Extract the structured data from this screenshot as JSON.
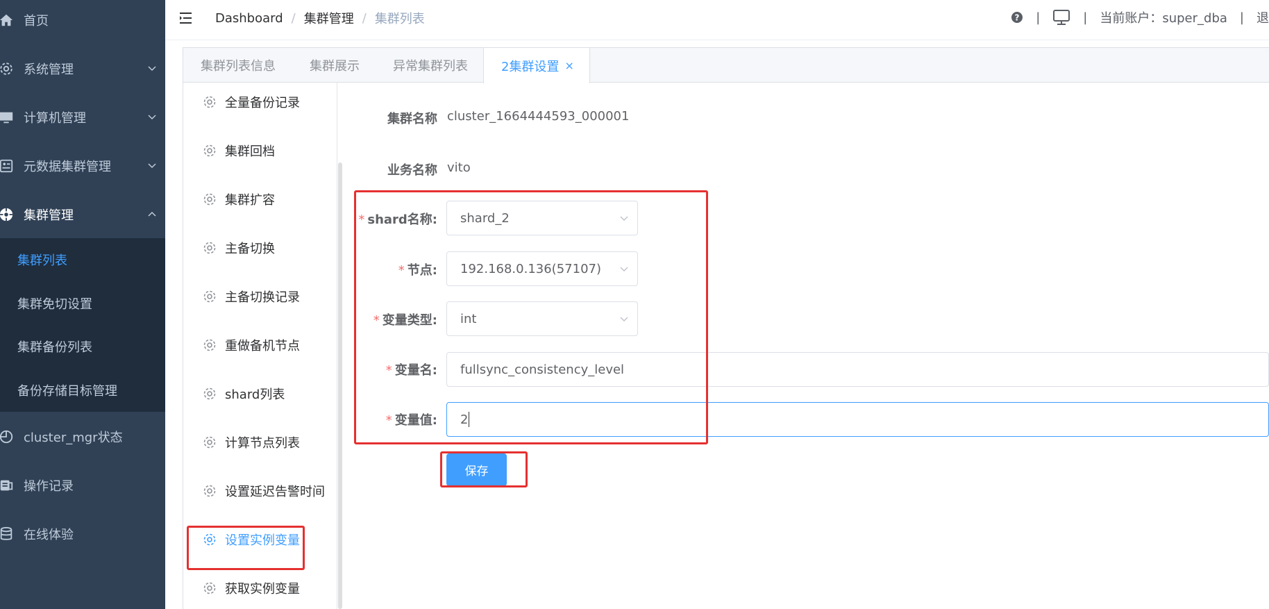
{
  "colors": {
    "sidebar_bg": "#304156",
    "submenu_bg": "#1f2d3d",
    "accent": "#409eff",
    "annotation_red": "#e53030",
    "required_star": "#f56c6c"
  },
  "sidebar": {
    "items": [
      {
        "label": "首页",
        "icon": "home-icon"
      },
      {
        "label": "系统管理",
        "icon": "gear-icon",
        "expandable": true
      },
      {
        "label": "计算机管理",
        "icon": "monitor-icon",
        "expandable": true
      },
      {
        "label": "元数据集群管理",
        "icon": "dashboard-icon",
        "expandable": true
      },
      {
        "label": "集群管理",
        "icon": "cluster-icon",
        "expandable": true,
        "expanded": true
      },
      {
        "label": "cluster_mgr状态",
        "icon": "target-icon"
      },
      {
        "label": "操作记录",
        "icon": "log-icon"
      },
      {
        "label": "在线体验",
        "icon": "database-icon"
      }
    ],
    "submenu": [
      {
        "label": "集群列表",
        "active": true
      },
      {
        "label": "集群免切设置"
      },
      {
        "label": "集群备份列表"
      },
      {
        "label": "备份存储目标管理"
      }
    ]
  },
  "navbar": {
    "breadcrumb": [
      "Dashboard",
      "集群管理",
      "集群列表"
    ],
    "separator": "/",
    "pipe": "|",
    "account_label": "当前账户：super_dba",
    "logout_partial": "退"
  },
  "tabs": [
    {
      "label": "集群列表信息"
    },
    {
      "label": "集群展示"
    },
    {
      "label": "异常集群列表"
    },
    {
      "label": "2集群设置",
      "active": true,
      "close": "×"
    }
  ],
  "side_menu": [
    {
      "label": "全量备份记录"
    },
    {
      "label": "集群回档"
    },
    {
      "label": "集群扩容"
    },
    {
      "label": "主备切换"
    },
    {
      "label": "主备切换记录"
    },
    {
      "label": "重做备机节点"
    },
    {
      "label": "shard列表"
    },
    {
      "label": "计算节点列表"
    },
    {
      "label": "设置延迟告警时间"
    },
    {
      "label": "设置实例变量",
      "active": true
    },
    {
      "label": "获取实例变量"
    }
  ],
  "form": {
    "cluster_name": {
      "label": "集群名称",
      "value": "cluster_1664444593_000001"
    },
    "business_name": {
      "label": "业务名称",
      "value": "vito"
    },
    "shard": {
      "label": "shard名称:",
      "value": "shard_2"
    },
    "node": {
      "label": "节点:",
      "value": "192.168.0.136(57107)"
    },
    "var_type": {
      "label": "变量类型:",
      "value": "int"
    },
    "var_name": {
      "label": "变量名:",
      "value": "fullsync_consistency_level"
    },
    "var_value": {
      "label": "变量值:",
      "value": "2"
    },
    "required_mark": "*",
    "save_label": "保存"
  }
}
